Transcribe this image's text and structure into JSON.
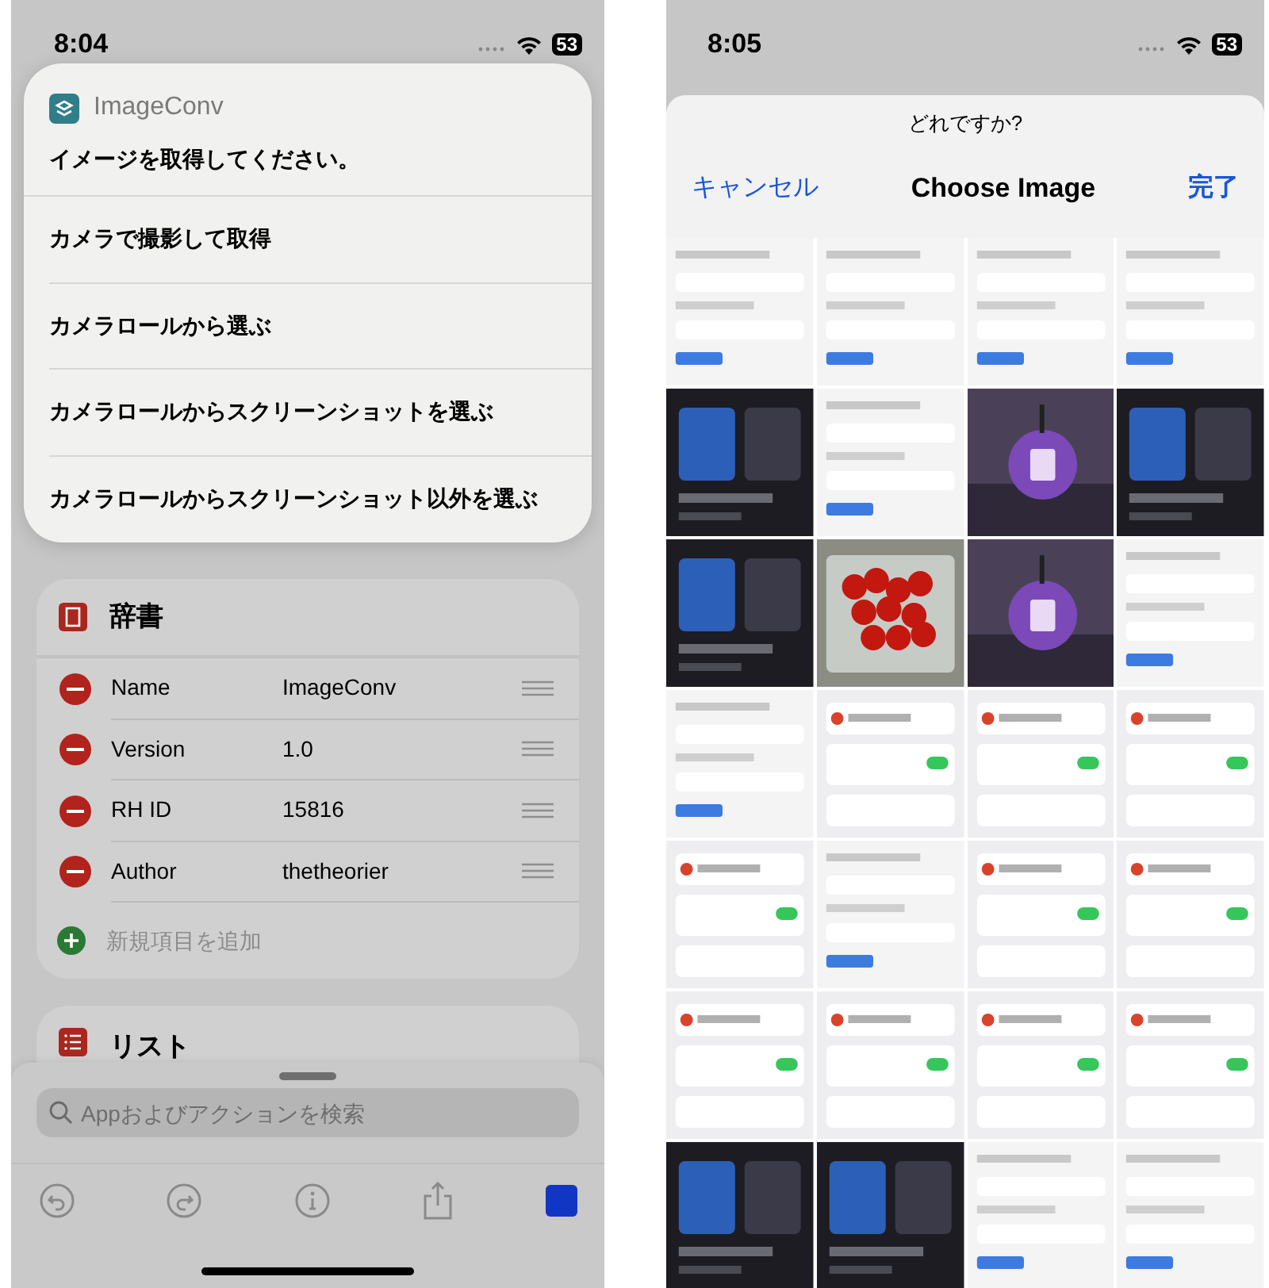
{
  "left": {
    "status_bar": {
      "time": "8:04",
      "battery": "53"
    },
    "alert": {
      "app_name": "ImageConv",
      "prompt": "イメージを取得してください。",
      "options": [
        "カメラで撮影して取得",
        "カメラロールから選ぶ",
        "カメラロールからスクリーンショットを選ぶ",
        "カメラロールからスクリーンショット以外を選ぶ"
      ]
    },
    "dictionary": {
      "title": "辞書",
      "rows": [
        {
          "key": "Name",
          "value": "ImageConv"
        },
        {
          "key": "Version",
          "value": "1.0"
        },
        {
          "key": "RH ID",
          "value": "15816"
        },
        {
          "key": "Author",
          "value": "thetheorier"
        }
      ],
      "add_label": "新規項目を追加"
    },
    "list": {
      "title": "リスト"
    },
    "search": {
      "placeholder": "Appおよびアクションを検索"
    },
    "toolbar": [
      {
        "kind": "undo"
      },
      {
        "kind": "redo"
      },
      {
        "kind": "info"
      },
      {
        "kind": "share"
      },
      {
        "kind": "stop"
      }
    ]
  },
  "right": {
    "status_bar": {
      "time": "8:05",
      "battery": "53"
    },
    "picker": {
      "subtitle": "どれですか?",
      "cancel": "キャンセル",
      "title": "Choose Image",
      "done": "完了"
    }
  }
}
